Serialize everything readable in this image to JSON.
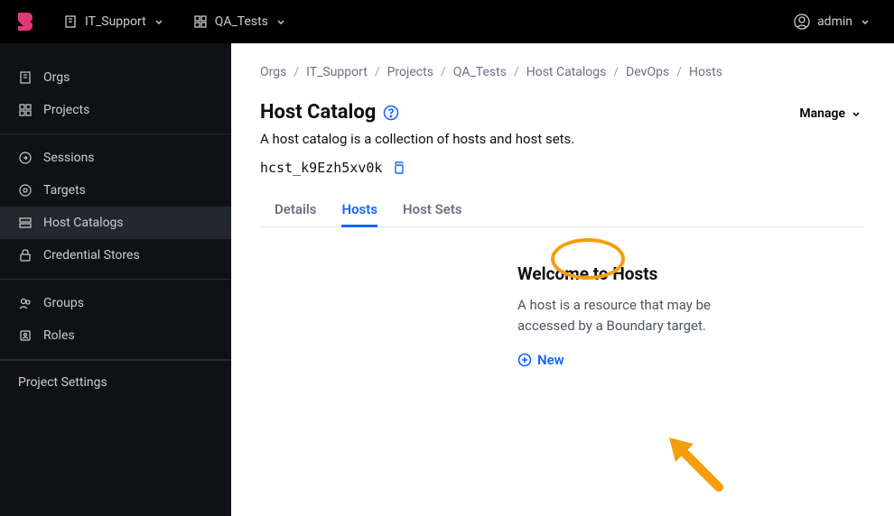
{
  "topbar": {
    "org_scope": "IT_Support",
    "project_scope": "QA_Tests",
    "user_name": "admin"
  },
  "sidebar": {
    "items": [
      {
        "label": "Orgs"
      },
      {
        "label": "Projects"
      },
      {
        "label": "Sessions"
      },
      {
        "label": "Targets"
      },
      {
        "label": "Host Catalogs"
      },
      {
        "label": "Credential Stores"
      },
      {
        "label": "Groups"
      },
      {
        "label": "Roles"
      }
    ],
    "settings_label": "Project Settings"
  },
  "breadcrumb": {
    "items": [
      "Orgs",
      "IT_Support",
      "Projects",
      "QA_Tests",
      "Host Catalogs",
      "DevOps",
      "Hosts"
    ]
  },
  "page": {
    "title": "Host Catalog",
    "description": "A host catalog is a collection of hosts and host sets.",
    "manage_label": "Manage",
    "resource_id": "hcst_k9Ezh5xv0k"
  },
  "tabs": {
    "items": [
      {
        "label": "Details",
        "active": false
      },
      {
        "label": "Hosts",
        "active": true
      },
      {
        "label": "Host Sets",
        "active": false
      }
    ]
  },
  "empty_state": {
    "title": "Welcome to Hosts",
    "description": "A host is a resource that may be accessed by a Boundary target.",
    "new_label": "New"
  },
  "colors": {
    "accent": "#1563ff",
    "annotation": "#f59e0b"
  }
}
